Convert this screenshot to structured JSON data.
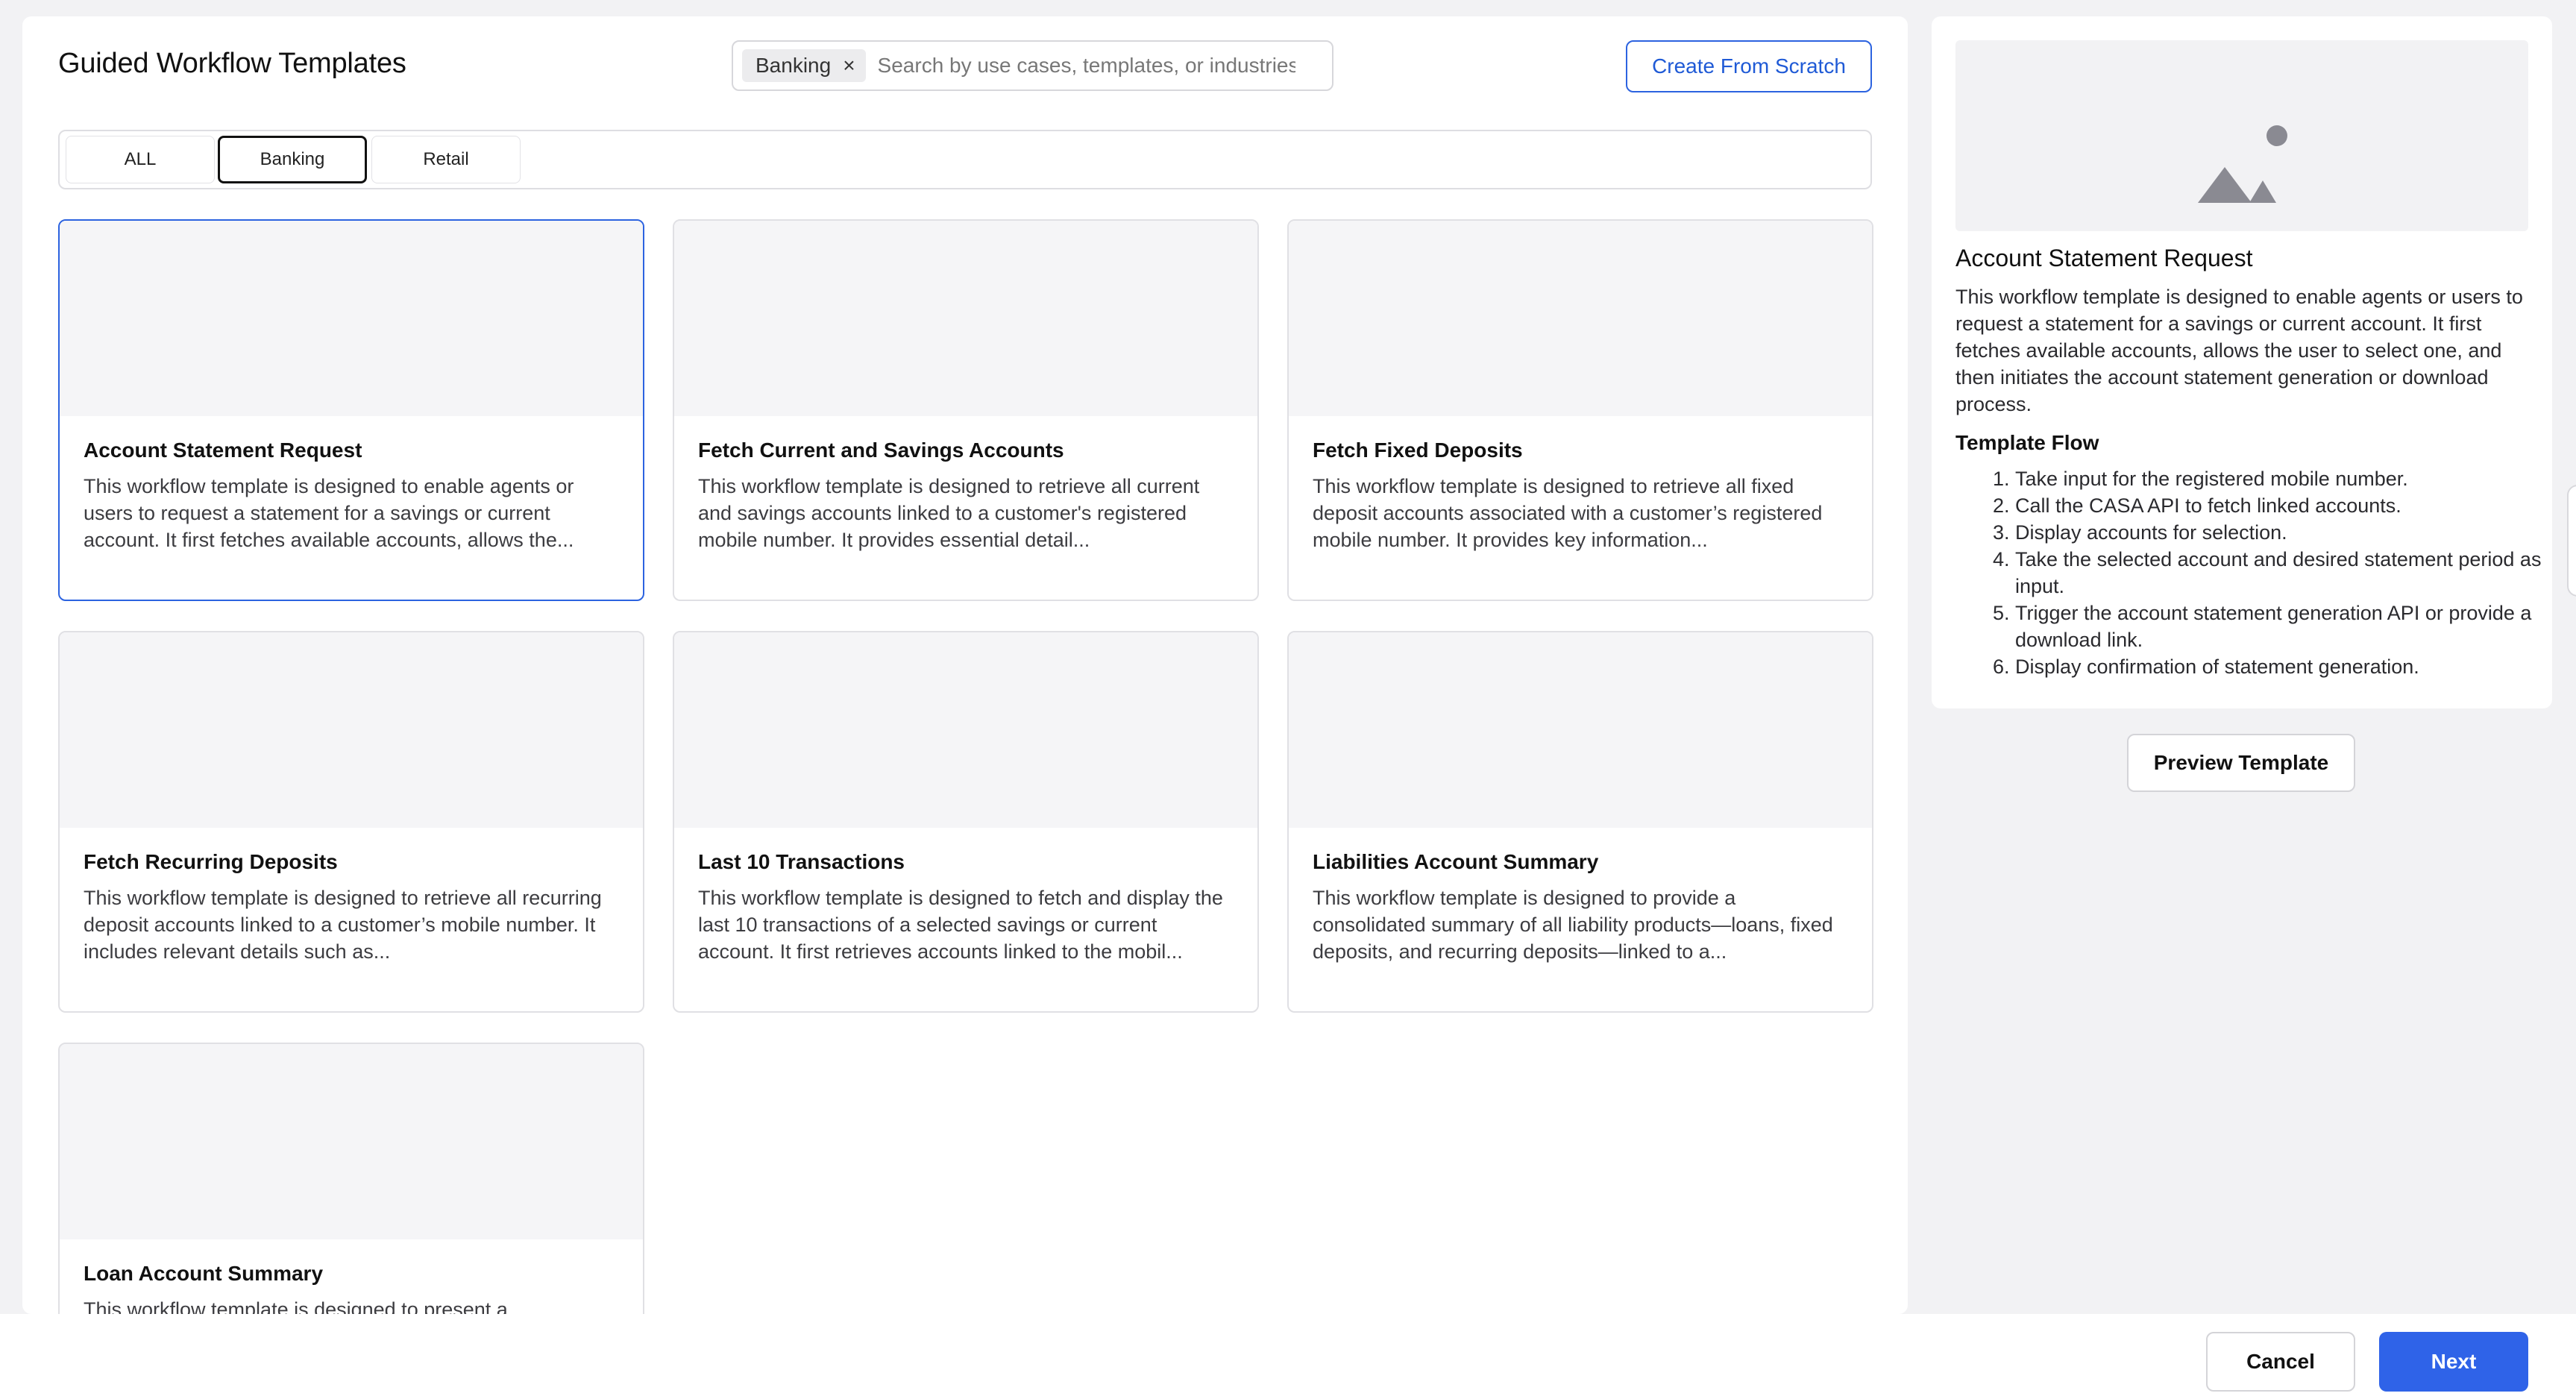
{
  "header": {
    "title": "Guided Workflow Templates",
    "create_button": "Create From Scratch"
  },
  "search": {
    "chip_label": "Banking",
    "chip_remove_icon": "×",
    "placeholder": "Search by use cases, templates, or industries"
  },
  "tabs": [
    {
      "label": "ALL",
      "active": false
    },
    {
      "label": "Banking",
      "active": true
    },
    {
      "label": "Retail",
      "active": false
    }
  ],
  "cards": [
    {
      "title": "Account Statement Request",
      "description": "This workflow template is designed to enable agents or users to request a statement for a savings or current account. It first fetches available accounts, allows the...",
      "selected": true
    },
    {
      "title": "Fetch Current and Savings Accounts",
      "description": "This workflow template is designed to retrieve all current and savings accounts linked to a customer's registered mobile number. It provides essential detail...",
      "selected": false
    },
    {
      "title": "Fetch Fixed Deposits",
      "description": "This workflow template is designed to retrieve all fixed deposit accounts associated with a customer’s registered mobile number. It provides key information...",
      "selected": false
    },
    {
      "title": "Fetch Recurring Deposits",
      "description": "This workflow template is designed to retrieve all recurring deposit accounts linked to a customer’s mobile number. It includes relevant details such as...",
      "selected": false
    },
    {
      "title": "Last 10 Transactions",
      "description": "This workflow template is designed to fetch and display the last 10 transactions of a selected savings or current account. It first retrieves accounts linked to the mobil...",
      "selected": false
    },
    {
      "title": "Liabilities Account Summary",
      "description": "This workflow template is designed to provide a consolidated summary of all liability products—loans, fixed deposits, and recurring deposits—linked to a...",
      "selected": false
    },
    {
      "title": "Loan Account Summary",
      "description": "This workflow template is designed to present a",
      "selected": false
    }
  ],
  "side_panel": {
    "image_icon": "image-placeholder-icon",
    "title": "Account Statement Request",
    "description": "This workflow template is designed to enable agents or users to request a statement for a savings or current account. It first fetches available accounts, allows the user to select one, and then initiates the account statement generation or download process.",
    "flow_heading": "Template Flow",
    "flow_steps": [
      "Take input for the registered mobile number.",
      "Call the CASA API to fetch linked accounts.",
      "Display accounts for selection.",
      "Take the selected account and desired statement period as input.",
      "Trigger the account statement generation API or provide a download link.",
      "Display confirmation of statement generation."
    ],
    "preview_button": "Preview Template"
  },
  "footer": {
    "cancel": "Cancel",
    "next": "Next"
  },
  "colors": {
    "accent": "#2f63e8",
    "selected_border": "#2c63e0",
    "thumbnail_bg": "#f5f5f7"
  }
}
